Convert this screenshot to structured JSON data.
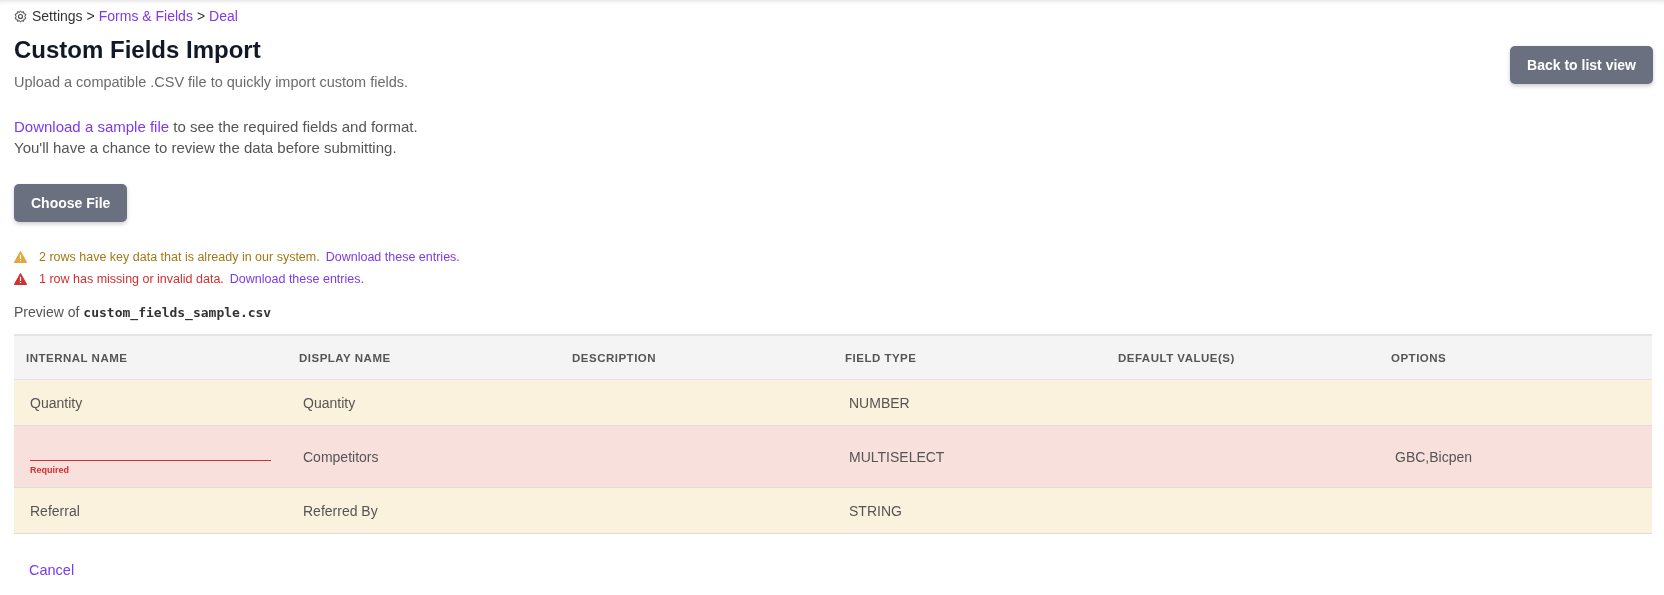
{
  "breadcrumb": {
    "separator": ">",
    "items": [
      {
        "label": "Settings",
        "link": false
      },
      {
        "label": "Forms & Fields",
        "link": true
      },
      {
        "label": "Deal",
        "link": true
      }
    ]
  },
  "title": "Custom Fields Import",
  "back_button": "Back to list view",
  "subtitle": "Upload a compatible .CSV file to quickly import custom fields.",
  "instructions": {
    "link": "Download a sample file",
    "text": "to see the required fields and format.",
    "note": "You'll have a chance to review the data before submitting."
  },
  "choose_file_button": "Choose File",
  "alerts": [
    {
      "kind": "warning",
      "message": "2 rows have key data that is already in our system.",
      "link": "Download these entries."
    },
    {
      "kind": "error",
      "message": "1 row has missing or invalid data.",
      "link": "Download these entries."
    }
  ],
  "preview": {
    "label": "Preview of",
    "file_name": "custom_fields_sample.csv"
  },
  "table": {
    "columns": [
      "INTERNAL NAME",
      "DISPLAY NAME",
      "DESCRIPTION",
      "FIELD TYPE",
      "DEFAULT VALUE(S)",
      "OPTIONS"
    ],
    "rows": [
      {
        "kind": "duplicate",
        "internal_name": "Quantity",
        "display_name": "Quantity",
        "field_type": "NUMBER"
      },
      {
        "kind": "invalid",
        "internal_name_error": "Required",
        "display_name": "Competitors",
        "field_type": "MULTISELECT",
        "options": "GBC,Bicpen"
      },
      {
        "kind": "duplicate",
        "internal_name": "Referral",
        "display_name": "Referred By",
        "field_type": "STRING"
      }
    ]
  },
  "cancel": "Cancel"
}
